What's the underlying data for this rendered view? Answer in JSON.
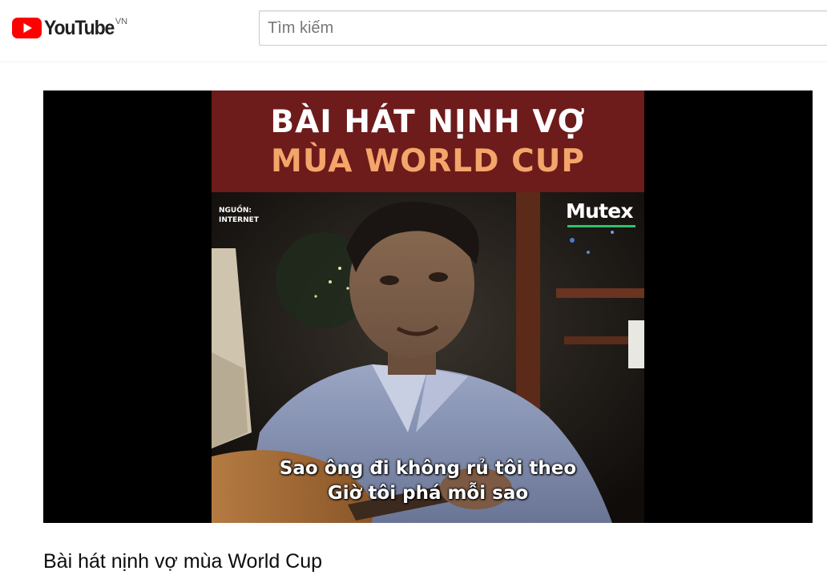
{
  "header": {
    "logo_text": "YouTube",
    "country_code": "VN",
    "search_placeholder": "Tìm kiếm"
  },
  "player": {
    "banner_line1": "BÀI HÁT NỊNH VỢ",
    "banner_line2": "MÙA WORLD CUP",
    "source_note": "NGUỒN:\nINTERNET",
    "brand_logo": "Mutex",
    "subtitle_line1": "Sao ông đi không rủ tôi theo",
    "subtitle_line2": "Giờ tôi phá mỗi sao"
  },
  "video": {
    "title": "Bài hát nịnh vợ mùa World Cup"
  },
  "colors": {
    "youtube_red": "#ff0000",
    "banner_bg": "#6e1b1b",
    "banner_accent": "#f4a56a",
    "brand_green": "#2ec36a"
  }
}
